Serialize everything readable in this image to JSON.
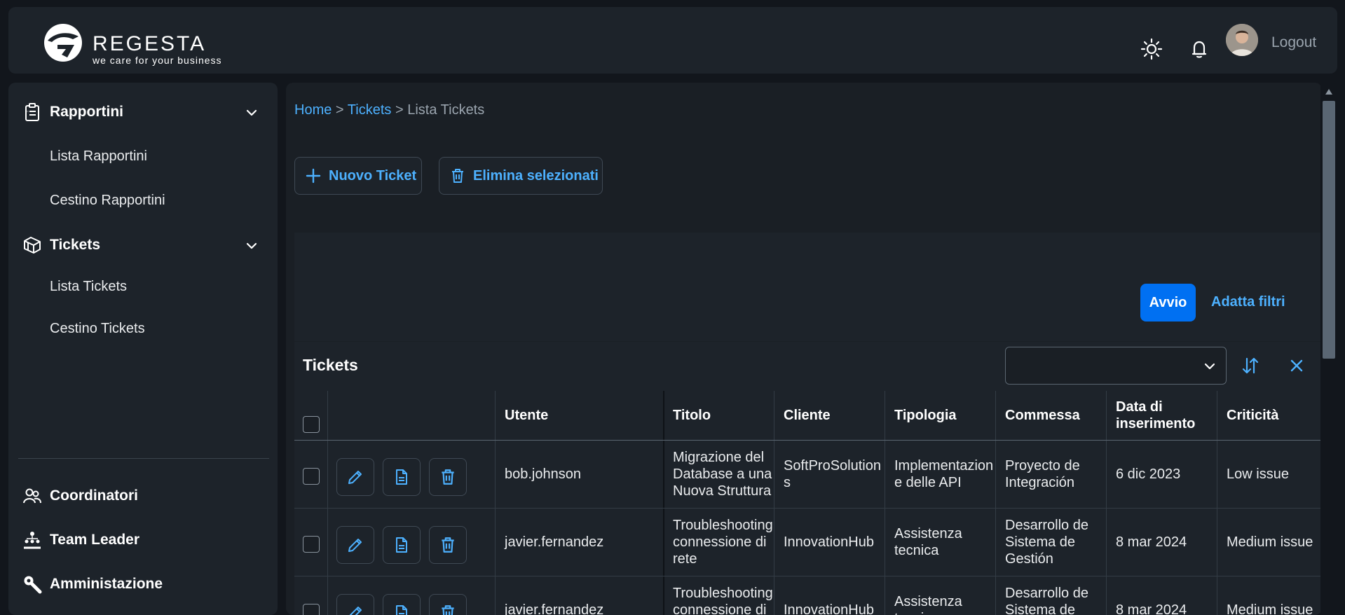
{
  "header": {
    "logo_name": "REGESTA",
    "logo_tagline": "we care for your business",
    "theme_icon": "sun-icon",
    "notification_icon": "bell-icon",
    "logout_label": "Logout"
  },
  "sidebar": {
    "groups": [
      {
        "label": "Rapportini",
        "icon": "clipboard-icon",
        "items": [
          "Lista Rapportini",
          "Cestino Rapportini"
        ]
      },
      {
        "label": "Tickets",
        "icon": "cubes-icon",
        "items": [
          "Lista Tickets",
          "Cestino Tickets"
        ]
      }
    ],
    "bottom": [
      {
        "label": "Coordinatori",
        "icon": "group-icon"
      },
      {
        "label": "Team Leader",
        "icon": "org-chart-icon"
      },
      {
        "label": "Amministazione",
        "icon": "wrench-icon"
      }
    ]
  },
  "breadcrumb": {
    "home": "Home",
    "sep1": " > ",
    "tickets": "Tickets",
    "sep2": " > ",
    "current": "Lista Tickets"
  },
  "actions": {
    "new_ticket": "Nuovo Ticket",
    "delete_selected": "Elimina selezionati"
  },
  "filterbar": {
    "go": "Avvio",
    "adapt_filters": "Adatta filtri"
  },
  "table": {
    "title": "Tickets",
    "select_value": "",
    "columns": [
      "Utente",
      "Titolo",
      "Cliente",
      "Tipologia",
      "Commessa",
      "Data di inserimento",
      "Criticità"
    ],
    "rows": [
      {
        "utente": "bob.johnson",
        "titolo": "Migrazione del Database a una Nuova Struttura",
        "cliente": "SoftProSolutions",
        "tipologia": "Implementazione delle API",
        "commessa": "Proyecto de Integración",
        "data": "6 dic 2023",
        "criticita": "Low issue"
      },
      {
        "utente": "javier.fernandez",
        "titolo": "Troubleshooting connessione di rete",
        "cliente": "InnovationHub",
        "tipologia": "Assistenza tecnica",
        "commessa": "Desarrollo de Sistema de Gestión",
        "data": "8 mar 2024",
        "criticita": "Medium issue"
      },
      {
        "utente": "javier.fernandez",
        "titolo": "Troubleshooting connessione di rete",
        "cliente": "InnovationHub",
        "tipologia": "Assistenza tecnica",
        "commessa": "Desarrollo de Sistema de Gestión",
        "data": "8 mar 2024",
        "criticita": "Medium issue"
      }
    ]
  },
  "colors": {
    "accent": "#4db1ff",
    "primary": "#0070f2",
    "surface": "#1d232a",
    "background": "#12161c"
  }
}
